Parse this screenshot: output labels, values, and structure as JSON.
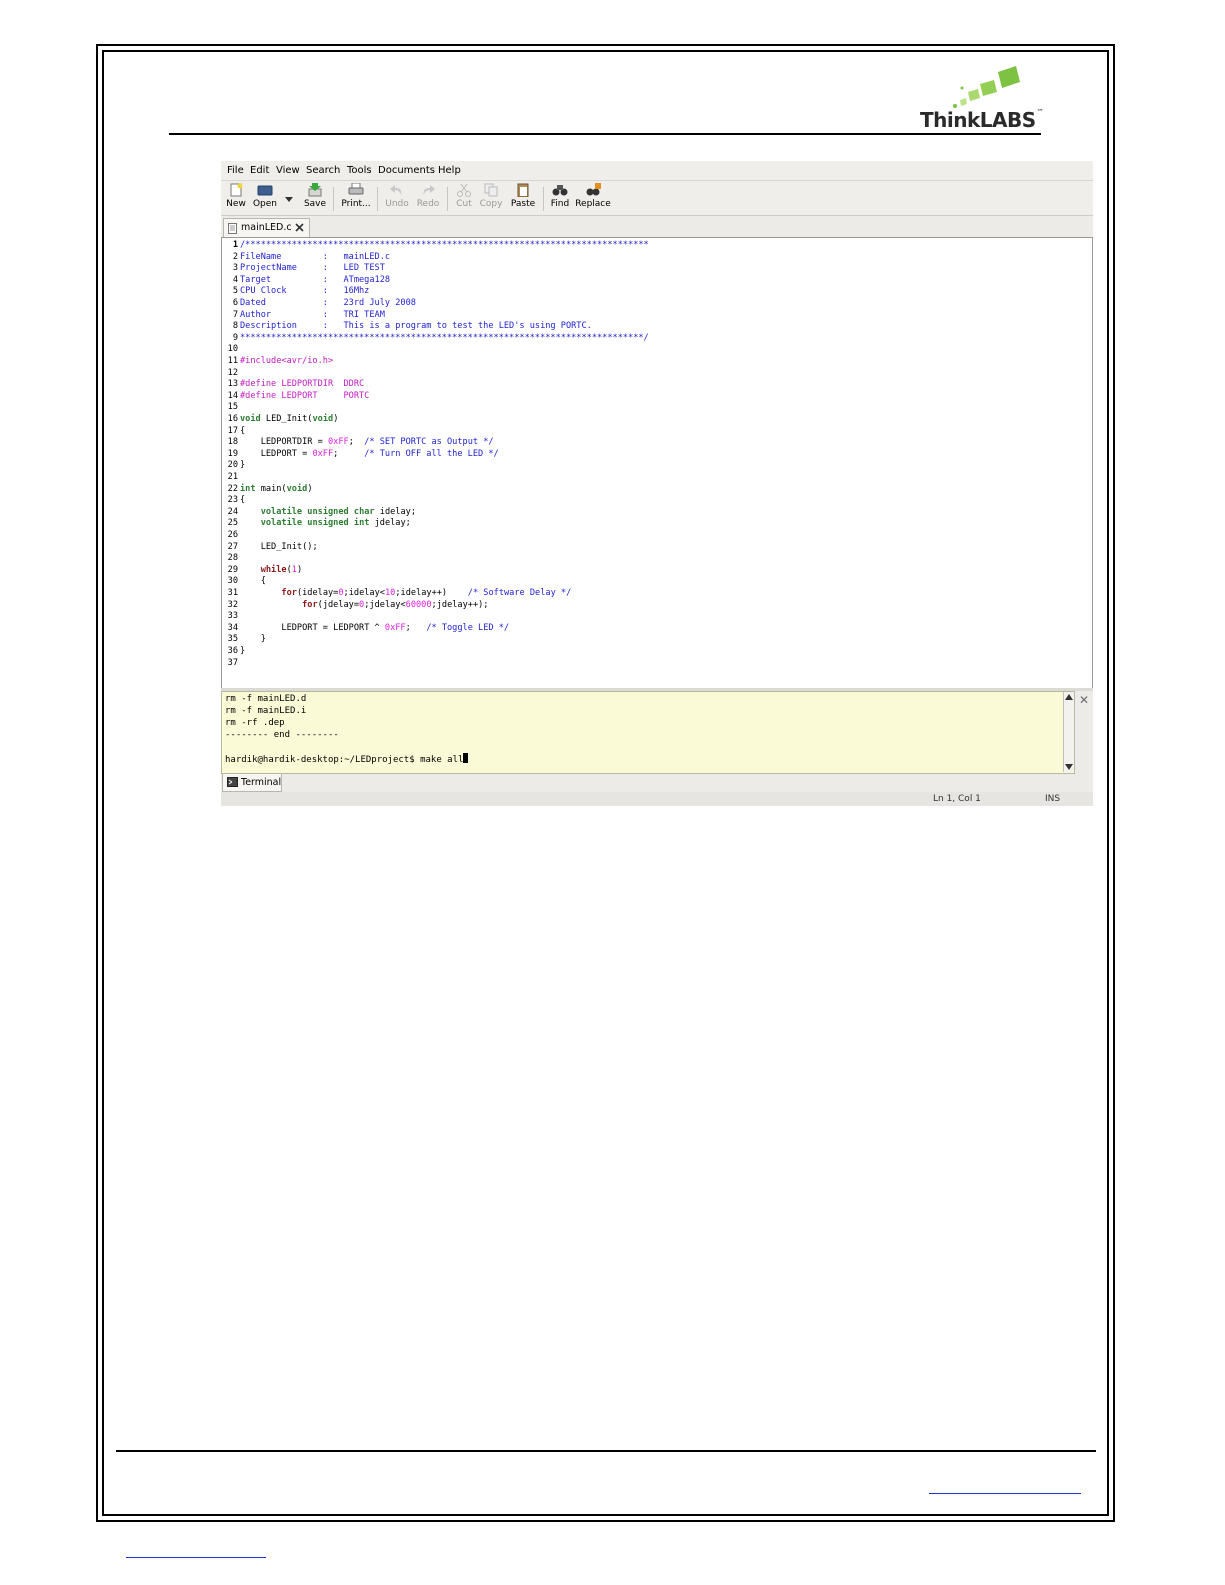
{
  "logo": {
    "name": "ThinkLABS",
    "mark": "™"
  },
  "editor": {
    "menu": [
      "File",
      "Edit",
      "View",
      "Search",
      "Tools",
      "Documents",
      "Help"
    ],
    "toolbar": {
      "new": "New",
      "open": "Open",
      "save": "Save",
      "print": "Print...",
      "undo": "Undo",
      "redo": "Redo",
      "cut": "Cut",
      "copy": "Copy",
      "paste": "Paste",
      "find": "Find",
      "replace": "Replace"
    },
    "tab_label": "mainLED.c",
    "code_lines": [
      {
        "n": "1",
        "t": "/******************************************************************************"
      },
      {
        "n": "2",
        "t": "FileName        :   mainLED.c"
      },
      {
        "n": "3",
        "t": "ProjectName     :   LED TEST"
      },
      {
        "n": "4",
        "t": "Target          :   ATmega128"
      },
      {
        "n": "5",
        "t": "CPU Clock       :   16Mhz"
      },
      {
        "n": "6",
        "t": "Dated           :   23rd July 2008"
      },
      {
        "n": "7",
        "t": "Author          :   TRI TEAM"
      },
      {
        "n": "8",
        "t": "Description     :   This is a program to test the LED's using PORTC."
      },
      {
        "n": "9",
        "t": "******************************************************************************/"
      },
      {
        "n": "10",
        "t": ""
      },
      {
        "n": "11",
        "t": "#include<avr/io.h>"
      },
      {
        "n": "12",
        "t": ""
      },
      {
        "n": "13",
        "t": "#define LEDPORTDIR  DDRC"
      },
      {
        "n": "14",
        "t": "#define LEDPORT     PORTC"
      },
      {
        "n": "15",
        "t": ""
      },
      {
        "n": "16",
        "t": "void LED_Init(void)"
      },
      {
        "n": "17",
        "t": "{"
      },
      {
        "n": "18",
        "t": "    LEDPORTDIR = 0xFF;  /* SET PORTC as Output */"
      },
      {
        "n": "19",
        "t": "    LEDPORT = 0xFF;     /* Turn OFF all the LED */"
      },
      {
        "n": "20",
        "t": "}"
      },
      {
        "n": "21",
        "t": ""
      },
      {
        "n": "22",
        "t": "int main(void)"
      },
      {
        "n": "23",
        "t": "{"
      },
      {
        "n": "24",
        "t": "    volatile unsigned char idelay;"
      },
      {
        "n": "25",
        "t": "    volatile unsigned int jdelay;"
      },
      {
        "n": "26",
        "t": ""
      },
      {
        "n": "27",
        "t": "    LED_Init();"
      },
      {
        "n": "28",
        "t": ""
      },
      {
        "n": "29",
        "t": "    while(1)"
      },
      {
        "n": "30",
        "t": "    {"
      },
      {
        "n": "31",
        "t": "        for(idelay=0;idelay<10;idelay++)    /* Software Delay */"
      },
      {
        "n": "32",
        "t": "            for(jdelay=0;jdelay<60000;jdelay++);"
      },
      {
        "n": "33",
        "t": ""
      },
      {
        "n": "34",
        "t": "        LEDPORT = LEDPORT ^ 0xFF;   /* Toggle LED */"
      },
      {
        "n": "35",
        "t": "    }"
      },
      {
        "n": "36",
        "t": "}"
      },
      {
        "n": "37",
        "t": ""
      }
    ],
    "terminal_lines": [
      "rm -f mainLED.d",
      "rm -f mainLED.i",
      "rm -rf .dep",
      "-------- end --------",
      "",
      "hardik@hardik-desktop:~/LEDproject$ make all"
    ],
    "terminal_tab": "Terminal",
    "status": {
      "position": "Ln 1, Col 1",
      "mode": "INS"
    }
  }
}
